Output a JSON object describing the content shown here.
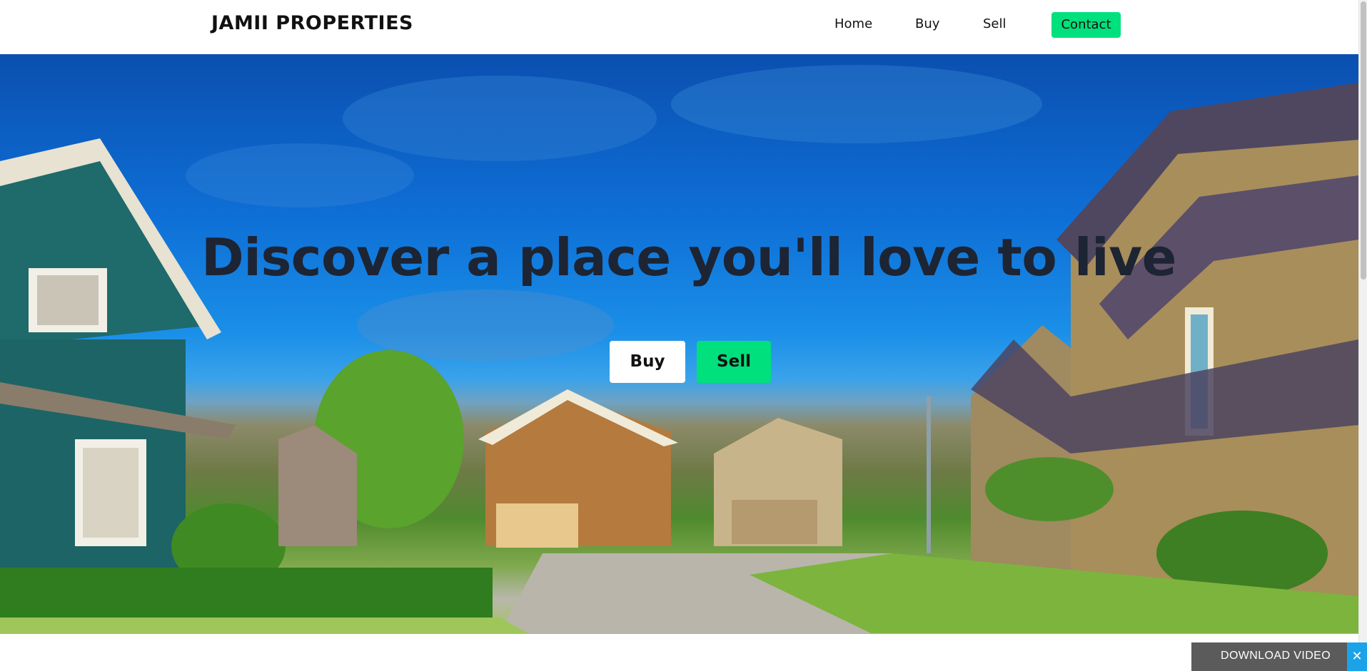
{
  "header": {
    "brand": "JAMII PROPERTIES",
    "nav": {
      "home": "Home",
      "buy": "Buy",
      "sell": "Sell",
      "contact": "Contact"
    }
  },
  "hero": {
    "headline": "Discover a place you'll love to live",
    "buttons": {
      "buy": "Buy",
      "sell": "Sell"
    }
  },
  "download_bar": {
    "label": "DOWNLOAD VIDEO",
    "close_glyph": "✕"
  },
  "colors": {
    "accent_green": "#00e07c",
    "headline_text": "#1d2433",
    "sky_blue": "#0e6fd6",
    "download_bar_bg": "#5b5b5b",
    "close_button_bg": "#1aa3e8"
  },
  "icons": {
    "close": "close-icon"
  }
}
